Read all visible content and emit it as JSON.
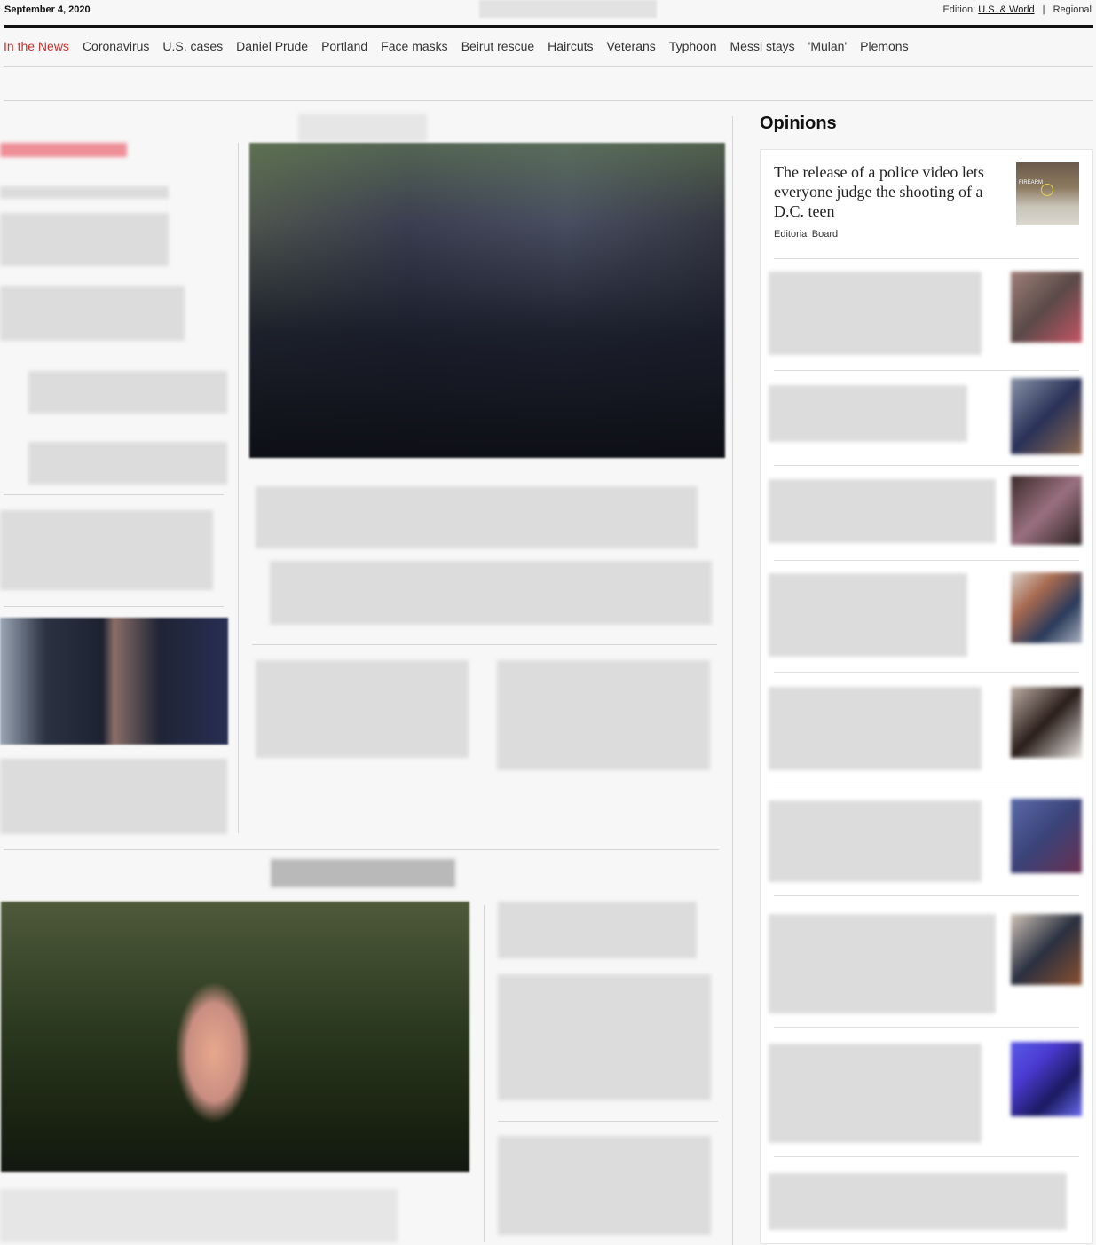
{
  "header": {
    "date": "September 4, 2020",
    "edition_label": "Edition:",
    "edition_us_world": "U.S. & World",
    "edition_separator": "|",
    "edition_regional": "Regional"
  },
  "nav": {
    "items": [
      "In the News",
      "Coronavirus",
      "U.S. cases",
      "Daniel Prude",
      "Portland",
      "Face masks",
      "Beirut rescue",
      "Haircuts",
      "Veterans",
      "Typhoon",
      "Messi stays",
      "'Mulan'",
      "Plemons"
    ]
  },
  "opinions": {
    "heading": "Opinions",
    "top_story": {
      "title": "The release of a police video lets everyone judge the shooting of a D.C. teen",
      "author": "Editorial Board",
      "thumb_tag": "FIREARM"
    }
  },
  "colors": {
    "accent_red": "#c8322b",
    "text": "#111111",
    "background": "#f7f7f7"
  }
}
